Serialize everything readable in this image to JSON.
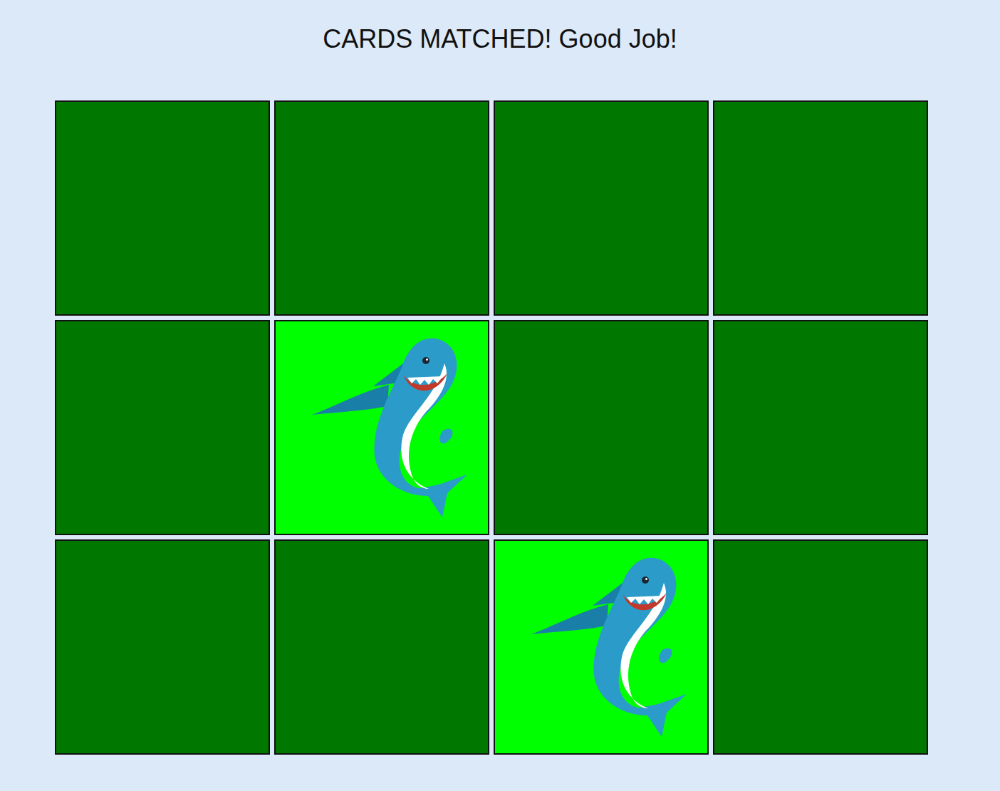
{
  "status": {
    "message": "CARDS MATCHED! Good Job!"
  },
  "cards": [
    {
      "face_up": false
    },
    {
      "face_up": false
    },
    {
      "face_up": false
    },
    {
      "face_up": false
    },
    {
      "face_up": false
    },
    {
      "face_up": true
    },
    {
      "face_up": false
    },
    {
      "face_up": false
    },
    {
      "face_up": false
    },
    {
      "face_up": false
    },
    {
      "face_up": true
    },
    {
      "face_up": false
    }
  ]
}
